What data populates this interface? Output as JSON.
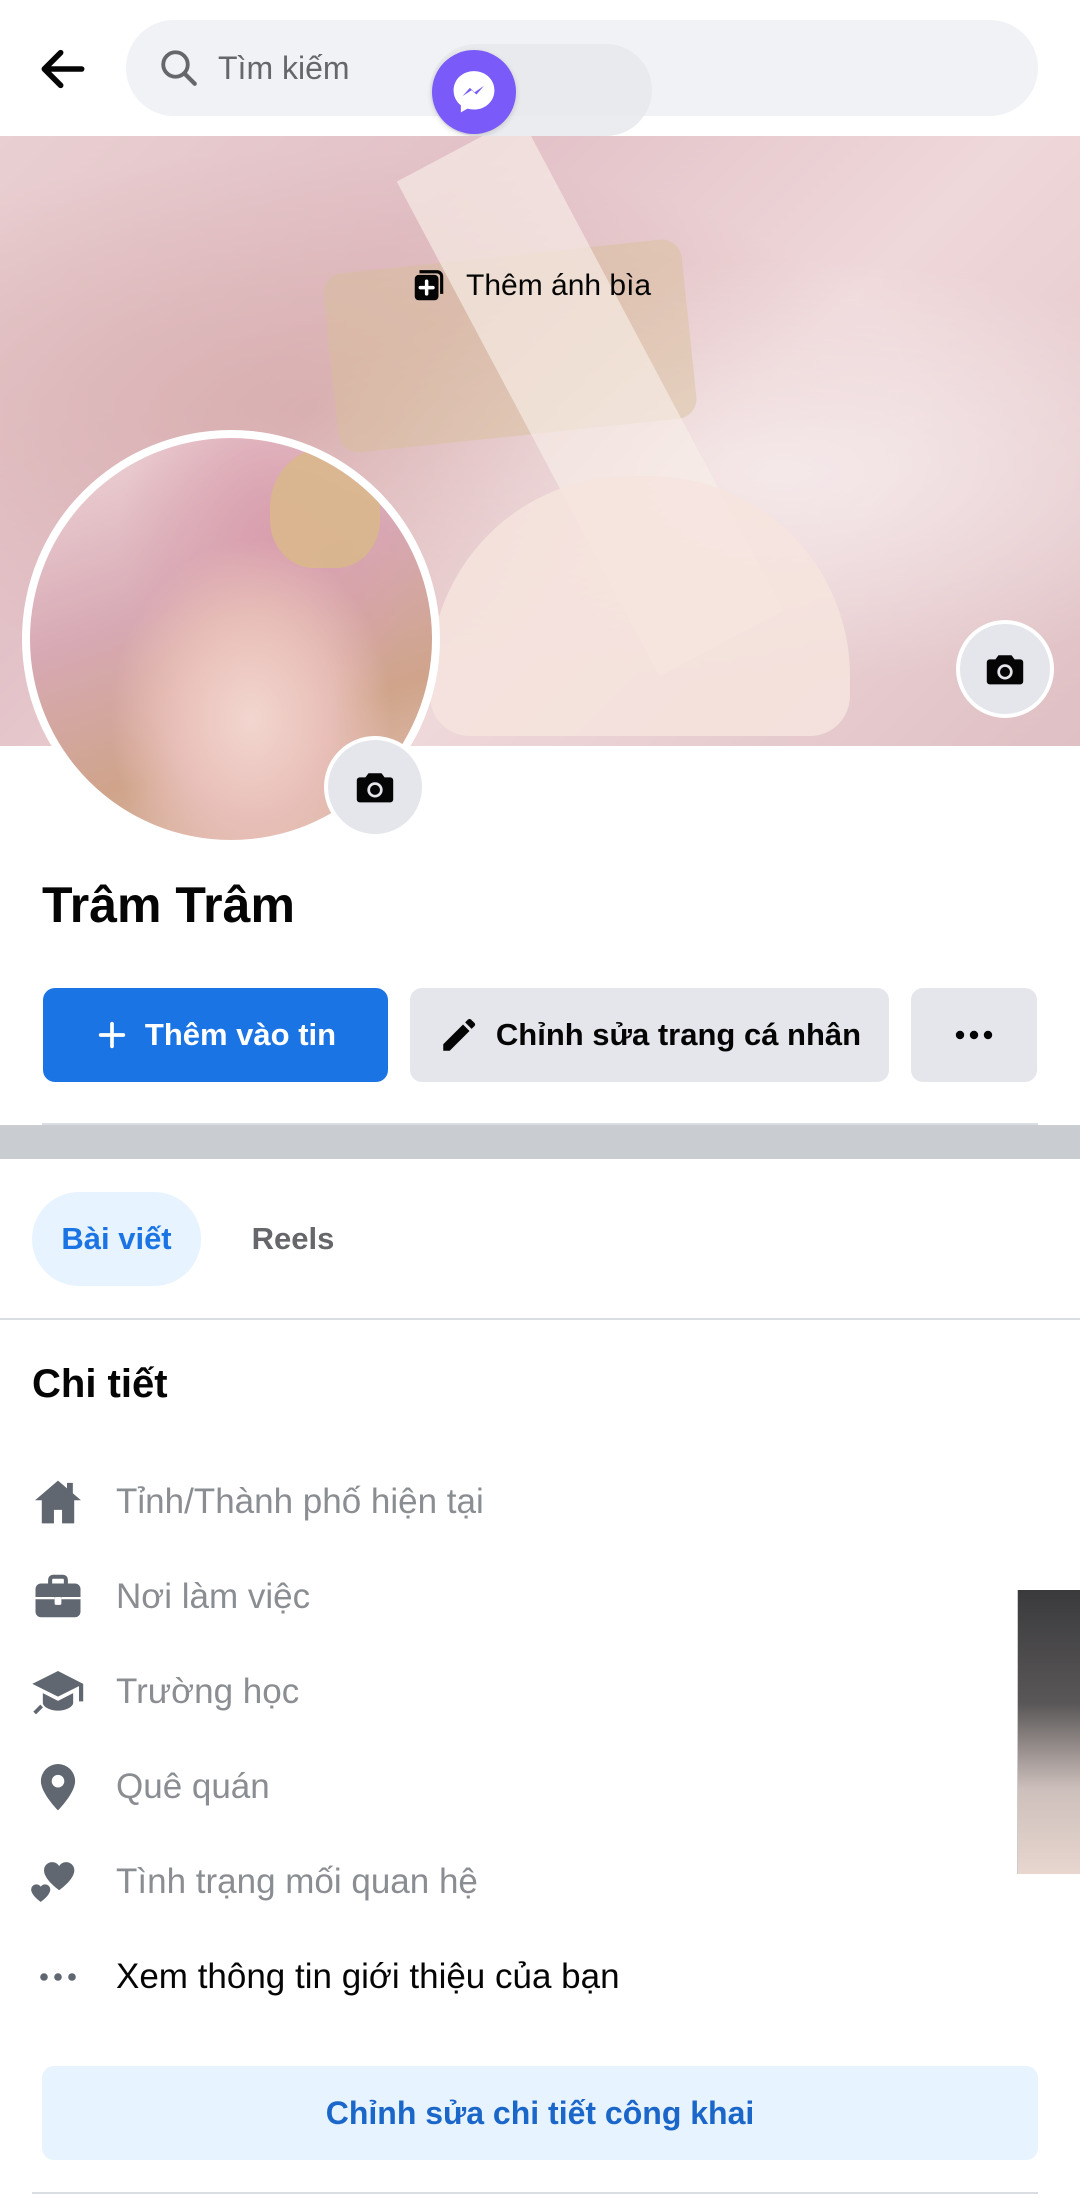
{
  "header": {
    "back_icon": "arrow-left-icon",
    "search_placeholder": "Tìm kiếm",
    "chathead_icon": "messenger-icon"
  },
  "cover": {
    "add_cover_label": "Thêm ánh bìa"
  },
  "profile": {
    "name": "Trâm Trâm"
  },
  "actions": {
    "add_story_label": "Thêm vào tin",
    "edit_profile_label": "Chỉnh sửa trang cá nhân",
    "more_icon": "more-dots-icon"
  },
  "tabs": [
    {
      "label": "Bài viết",
      "active": true
    },
    {
      "label": "Reels",
      "active": false
    }
  ],
  "details": {
    "title": "Chi tiết",
    "items": [
      {
        "icon": "home-icon",
        "label": "Tỉnh/Thành phố hiện tại"
      },
      {
        "icon": "briefcase-icon",
        "label": "Nơi làm việc"
      },
      {
        "icon": "graduation-cap-icon",
        "label": "Trường học"
      },
      {
        "icon": "location-pin-icon",
        "label": "Quê quán"
      },
      {
        "icon": "hearts-icon",
        "label": "Tình trạng mối quan hệ"
      },
      {
        "icon": "more-dots-icon",
        "label": "Xem thông tin giới thiệu của bạn"
      }
    ],
    "edit_public_label": "Chỉnh sửa chi tiết công khai"
  },
  "colors": {
    "primary": "#1b74e4",
    "secondary_button": "#e4e6eb",
    "light_blue": "#e7f3ff",
    "muted_text": "#8a8d91",
    "messenger": "#7a5af8"
  }
}
